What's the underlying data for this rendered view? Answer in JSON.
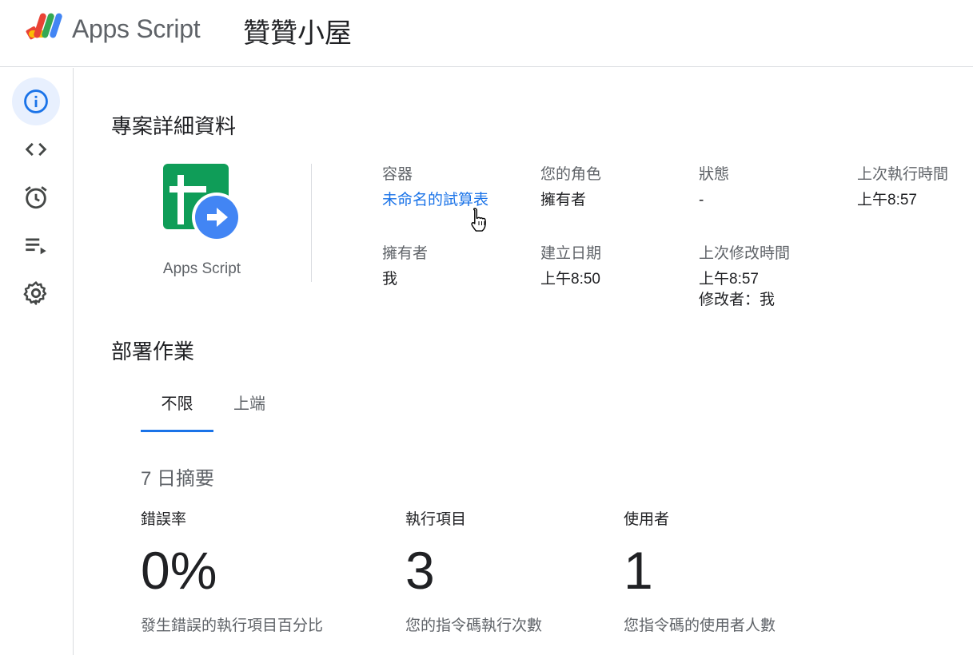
{
  "header": {
    "app_name": "Apps Script",
    "project_title": "贊贊小屋"
  },
  "sidebar": {
    "items": [
      {
        "name": "overview",
        "icon": "info-icon",
        "active": true
      },
      {
        "name": "editor",
        "icon": "code-icon",
        "active": false
      },
      {
        "name": "triggers",
        "icon": "alarm-clock-icon",
        "active": false
      },
      {
        "name": "executions",
        "icon": "playlist-play-icon",
        "active": false
      },
      {
        "name": "settings",
        "icon": "gear-icon",
        "active": false
      }
    ]
  },
  "details": {
    "title": "專案詳細資料",
    "app_icon_label": "Apps Script",
    "container_label": "容器",
    "container_value": "未命名的試算表",
    "role_label": "您的角色",
    "role_value": "擁有者",
    "status_label": "狀態",
    "status_value": "-",
    "last_run_label": "上次執行時間",
    "last_run_value": "上午8:57",
    "owner_label": "擁有者",
    "owner_value": "我",
    "created_label": "建立日期",
    "created_value": "上午8:50",
    "modified_label": "上次修改時間",
    "modified_value": "上午8:57",
    "modified_by": "修改者：我"
  },
  "deployments": {
    "title": "部署作業",
    "tabs": [
      {
        "label": "不限",
        "active": true
      },
      {
        "label": "上端",
        "active": false
      }
    ]
  },
  "summary": {
    "title": "7 日摘要",
    "stats": [
      {
        "label": "錯誤率",
        "value": "0%",
        "desc": "發生錯誤的執行項目百分比"
      },
      {
        "label": "執行項目",
        "value": "3",
        "desc": "您的指令碼執行次數"
      },
      {
        "label": "使用者",
        "value": "1",
        "desc": "您指令碼的使用者人數"
      }
    ]
  },
  "colors": {
    "accent": "#1a73e8",
    "active_nav_bg": "#e8f0fe",
    "text_primary": "#202124",
    "text_secondary": "#5f6368",
    "divider": "#dadce0"
  }
}
